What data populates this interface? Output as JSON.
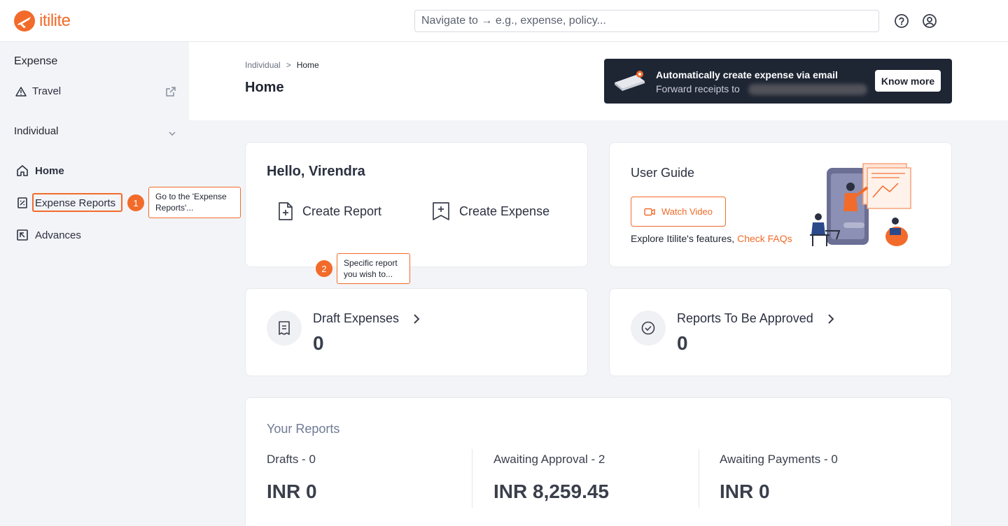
{
  "brand": {
    "name": "itilite",
    "color": "#f26b2a"
  },
  "search": {
    "placeholder": "Navigate to → e.g., expense, policy..."
  },
  "topbar": {
    "help_icon": "help-circle-icon",
    "profile_icon": "user-circle-icon"
  },
  "sidebar": {
    "section_expense": "Expense",
    "travel": "Travel",
    "section_individual": "Individual",
    "items": [
      {
        "label": "Home",
        "icon": "home-icon",
        "active": true
      },
      {
        "label": "Expense Reports",
        "icon": "report-icon"
      },
      {
        "label": "Advances",
        "icon": "advance-icon"
      }
    ]
  },
  "breadcrumb": {
    "parent": "Individual",
    "separator": ">",
    "current": "Home"
  },
  "page": {
    "title": "Home"
  },
  "banner": {
    "title": "Automatically create expense via email",
    "subtitle": "Forward receipts to",
    "button": "Know more"
  },
  "hello_card": {
    "greeting": "Hello, Virendra",
    "create_report": "Create Report",
    "create_expense": "Create Expense"
  },
  "guide_card": {
    "title": "User Guide",
    "watch_video": "Watch Video",
    "explore": "Explore Itilite's features,",
    "faq": "Check FAQs"
  },
  "stats": [
    {
      "label": "Draft Expenses",
      "value": "0",
      "icon": "receipt-icon"
    },
    {
      "label": "Reports To Be Approved",
      "value": "0",
      "icon": "check-circle-icon"
    }
  ],
  "your_reports": {
    "title": "Your Reports",
    "columns": [
      {
        "label": "Drafts - 0",
        "value": "INR 0"
      },
      {
        "label": "Awaiting Approval - 2",
        "value": "INR 8,259.45"
      },
      {
        "label": "Awaiting Payments - 0",
        "value": "INR 0"
      }
    ]
  },
  "tutorial": {
    "step1": {
      "number": "1",
      "line1": "Go to the 'Expense",
      "line2": "Reports'..."
    },
    "step2": {
      "number": "2",
      "line1": "Specific report",
      "line2": "you wish to..."
    }
  }
}
